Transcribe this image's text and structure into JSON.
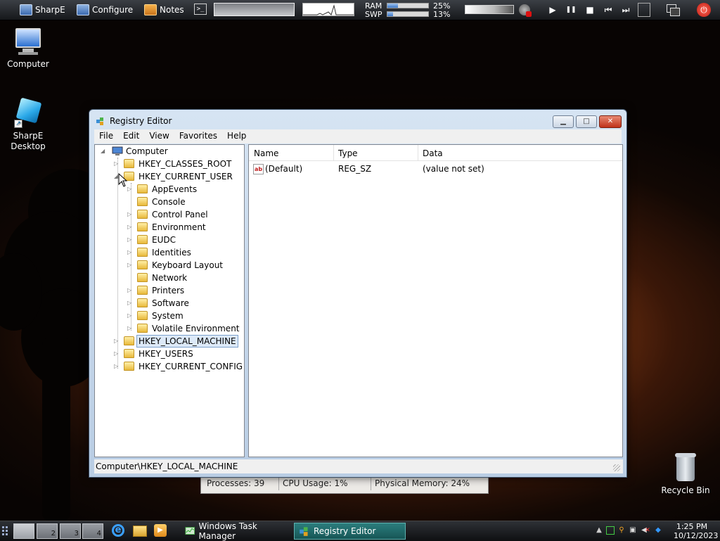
{
  "topbar": {
    "sharpe_label": "SharpE",
    "configure_label": "Configure",
    "notes_label": "Notes",
    "terminal_glyph": ">_",
    "ram_label": "RAM",
    "swp_label": "SWP",
    "ram_value": "25%",
    "swp_value": "13%",
    "ram_fraction": 0.25,
    "swp_fraction": 0.13,
    "media": {
      "play": "▶",
      "pause": "❚❚",
      "stop": "■",
      "prev": "⏮",
      "next": "⏭"
    },
    "power_glyph": "⏻"
  },
  "desktop": {
    "computer_label": "Computer",
    "sharpe_desktop_label": "SharpE Desktop",
    "recycle_bin_label": "Recycle Bin"
  },
  "task_manager_strip": {
    "processes": "Processes: 39",
    "cpu": "CPU Usage: 1%",
    "memory": "Physical Memory: 24%"
  },
  "regedit": {
    "title": "Registry Editor",
    "menu": [
      "File",
      "Edit",
      "View",
      "Favorites",
      "Help"
    ],
    "tree": {
      "root": "Computer",
      "hives": {
        "classes_root": "HKEY_CLASSES_ROOT",
        "current_user": "HKEY_CURRENT_USER",
        "local_machine": "HKEY_LOCAL_MACHINE",
        "users": "HKEY_USERS",
        "current_config": "HKEY_CURRENT_CONFIG"
      },
      "current_user_children": [
        "AppEvents",
        "Console",
        "Control Panel",
        "Environment",
        "EUDC",
        "Identities",
        "Keyboard Layout",
        "Network",
        "Printers",
        "Software",
        "System",
        "Volatile Environment"
      ]
    },
    "columns": {
      "name": "Name",
      "type": "Type",
      "data": "Data"
    },
    "values": [
      {
        "name": "(Default)",
        "type": "REG_SZ",
        "data": "(value not set)"
      }
    ],
    "status": "Computer\\HKEY_LOCAL_MACHINE"
  },
  "taskbar": {
    "desktops": [
      "",
      "2",
      "3",
      "4"
    ],
    "tasks": {
      "task_manager": "Windows Task Manager",
      "registry_editor": "Registry Editor"
    },
    "clock_time": "1:25 PM",
    "clock_date": "10/12/2023"
  },
  "colors": {
    "selection_bg": "#dce9f8",
    "active_task": "#2b7d7d",
    "power_red": "#c01a10"
  }
}
